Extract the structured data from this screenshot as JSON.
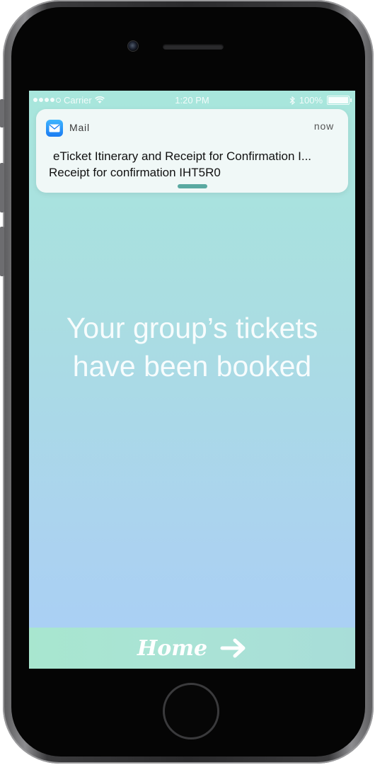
{
  "status_bar": {
    "carrier": "Carrier",
    "time": "1:20 PM",
    "battery": "100%",
    "bluetooth_icon": "bluetooth-icon",
    "wifi_icon": "wifi-icon"
  },
  "notification": {
    "app_name": "Mail",
    "time": "now",
    "title": "eTicket Itinerary and Receipt for Confirmation I...",
    "body": "Receipt for confirmation IHT5R0",
    "icon": "mail-icon"
  },
  "main": {
    "headline_line1": "Your group’s tickets",
    "headline_line2": "have been booked"
  },
  "footer": {
    "home_label": "Home",
    "arrow_icon": "arrow-right-icon"
  },
  "colors": {
    "screen_top": "#a8e6dc",
    "screen_bottom": "#a9cff6",
    "footer_bar": "#a8e6cf",
    "mail_icon": "#1a7bf2",
    "handle": "#5aa9a1"
  }
}
